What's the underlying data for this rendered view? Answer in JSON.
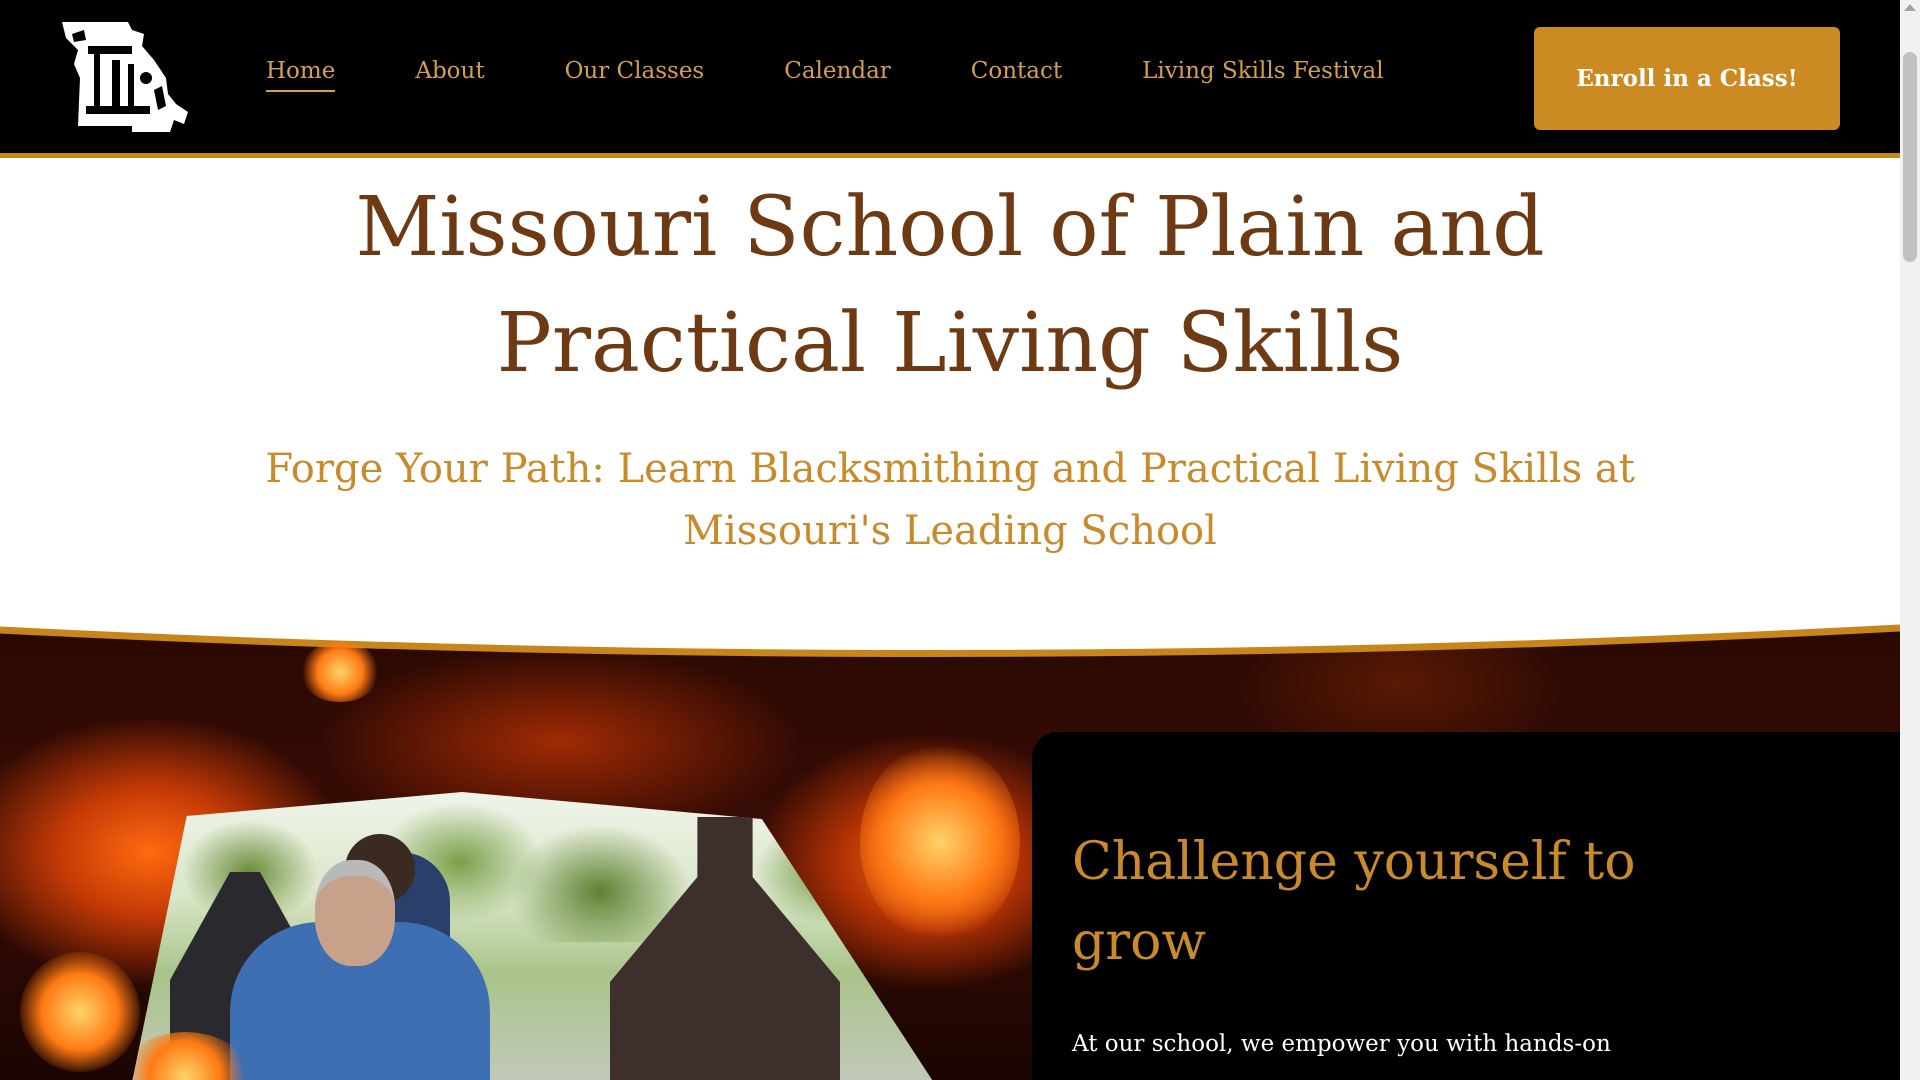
{
  "nav": {
    "items": [
      {
        "label": "Home",
        "active": true
      },
      {
        "label": "About",
        "active": false
      },
      {
        "label": "Our Classes",
        "active": false
      },
      {
        "label": "Calendar",
        "active": false
      },
      {
        "label": "Contact",
        "active": false
      },
      {
        "label": "Living Skills Festival",
        "active": false
      }
    ],
    "cta_label": "Enroll in a Class!"
  },
  "logo": {
    "icon": "missouri-tools-logo-icon"
  },
  "hero": {
    "title": "Missouri School of Plain and Practical Living Skills",
    "subtitle": "Forge Your Path: Learn Blacksmithing and Practical Living Skills at Missouri's Leading School"
  },
  "feature": {
    "title": "Challenge yourself to grow",
    "body": "At our school, we empower you with hands-on"
  },
  "colors": {
    "header_bg": "#000000",
    "accent": "#cc8a22",
    "nav_text": "#d4a050",
    "title_brown": "#6e3a13",
    "subtitle_gold": "#c88a2a"
  }
}
